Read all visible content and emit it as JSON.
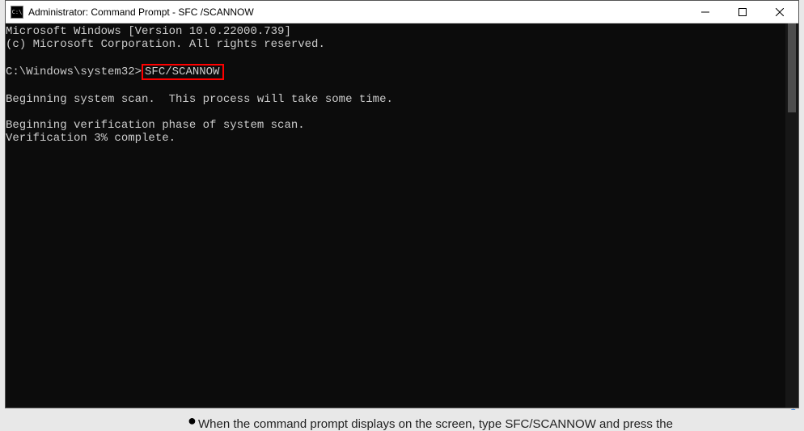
{
  "window": {
    "title": "Administrator: Command Prompt - SFC /SCANNOW"
  },
  "terminal": {
    "line1": "Microsoft Windows [Version 10.0.22000.739]",
    "line2": "(c) Microsoft Corporation. All rights reserved.",
    "blank1": "",
    "prompt_prefix": "C:\\Windows\\system32>",
    "command": "SFC/SCANNOW",
    "blank2": "",
    "line3": "Beginning system scan.  This process will take some time.",
    "blank3": "",
    "line4": "Beginning verification phase of system scan.",
    "line5": "Verification 3% complete."
  },
  "background": {
    "bullet": "●",
    "text": "When the command prompt displays on the screen, type SFC/SCANNOW and press the"
  }
}
